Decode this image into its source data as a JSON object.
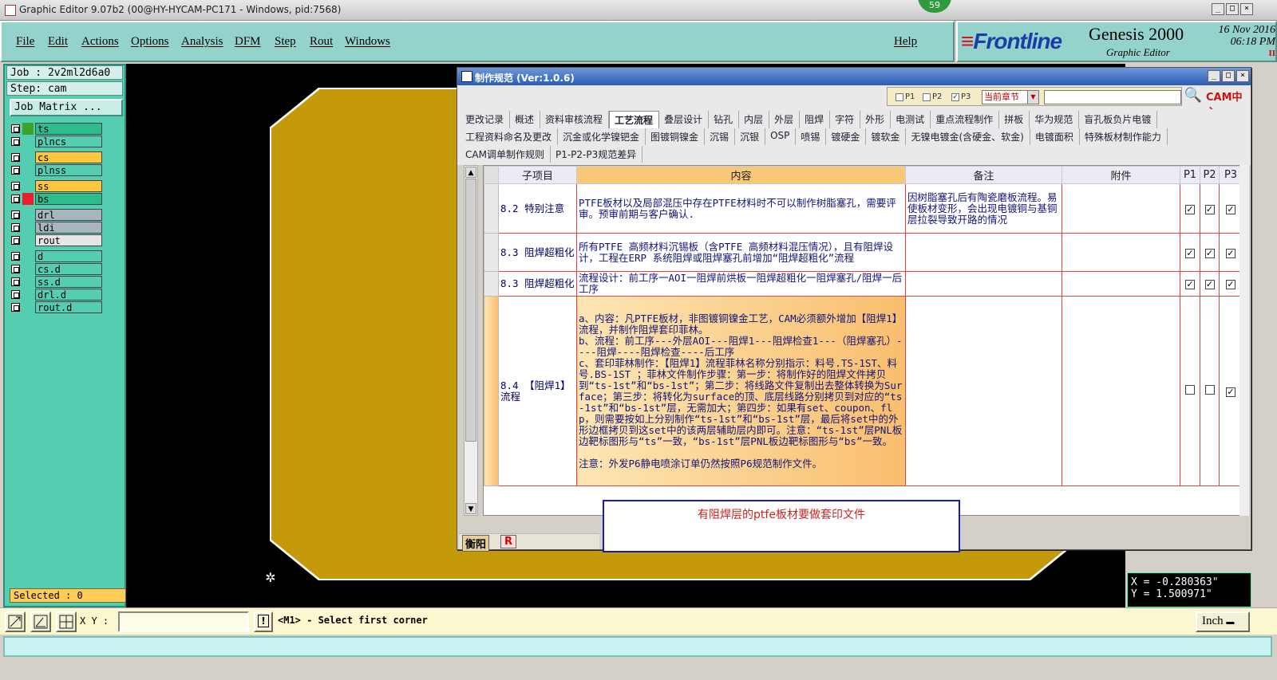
{
  "titlebar": {
    "title": "Graphic Editor 9.07b2 (00@HY-HYCAM-PC171 - Windows, pid:7568)",
    "min": "_",
    "max": "□",
    "close": "×"
  },
  "badge": "59",
  "menu": [
    "File",
    "Edit",
    "Actions",
    "Options",
    "Analysis",
    "DFM",
    "Step",
    "Rout",
    "Windows"
  ],
  "help": "Help",
  "brand": {
    "logo_mark": "≡",
    "logo": "Frontline",
    "product": "Genesis 2000",
    "sub": "Graphic Editor",
    "date": "16 Nov 2016",
    "time": "06:18 PM",
    "indicator": "II"
  },
  "left": {
    "job": "Job : 2v2ml2d6a0",
    "step": "Step: cam",
    "job_matrix": "Job Matrix ...",
    "selected": "Selected : 0"
  },
  "layers": [
    {
      "name": "ts",
      "color": "#2dbd8a",
      "swatch": "#3ca22e"
    },
    {
      "name": "plncs",
      "color": "#55cdb0",
      "swatch": "#55cdb0"
    },
    {
      "name": "cs",
      "color": "#ffc73b",
      "swatch": "#55cdb0"
    },
    {
      "name": "plnss",
      "color": "#55cdb0",
      "swatch": "#55cdb0"
    },
    {
      "name": "ss",
      "color": "#ffc73b",
      "swatch": "#55cdb0"
    },
    {
      "name": "bs",
      "color": "#2dbd8a",
      "swatch": "#e8202b"
    },
    {
      "name": "drl",
      "color": "#a8b6c0",
      "swatch": "#55cdb0"
    },
    {
      "name": "ldi",
      "color": "#a8b6c0",
      "swatch": "#55cdb0"
    },
    {
      "name": "rout",
      "color": "#e6e6e6",
      "swatch": "#55cdb0"
    },
    {
      "name": "d",
      "color": "#55cdb0",
      "swatch": "#55cdb0"
    },
    {
      "name": "cs.d",
      "color": "#55cdb0",
      "swatch": "#55cdb0"
    },
    {
      "name": "ss.d",
      "color": "#55cdb0",
      "swatch": "#55cdb0"
    },
    {
      "name": "drl.d",
      "color": "#55cdb0",
      "swatch": "#55cdb0"
    },
    {
      "name": "rout.d",
      "color": "#55cdb0",
      "swatch": "#55cdb0"
    }
  ],
  "coords": {
    "x": "X = -0.280363\"",
    "y": "Y = 1.500971\""
  },
  "bottom": {
    "xy_label": "X Y :",
    "xy_value": "",
    "warn": "!",
    "prompt": "<M1> - Select first corner",
    "unit": "Inch"
  },
  "dialog": {
    "title": "制作规范 (Ver:1.0.6)",
    "filters": [
      {
        "label": "P1",
        "checked": false
      },
      {
        "label": "P2",
        "checked": false
      },
      {
        "label": "P3",
        "checked": true
      }
    ],
    "chapter": "当前章节",
    "search_icon": "magnifier-icon",
    "cam_logo": "CAM",
    "cam_logo2": "中心",
    "tabs_row1": [
      "更改记录",
      "概述",
      "资料审核流程",
      "工艺流程",
      "叠层设计",
      "钻孔",
      "内层",
      "外层",
      "阻焊",
      "字符",
      "外形",
      "电测试",
      "重点流程制作",
      "拼板",
      "华为规范",
      "盲孔板负片电镀"
    ],
    "tabs_row2": [
      "工程资料命名及更改",
      "沉金或化学镍钯金",
      "图镀铜镍金",
      "沉锡",
      "沉银",
      "OSP",
      "喷锡",
      "镀硬金",
      "镀软金",
      "无镍电镀金(含硬金、软金)",
      "电镀面积",
      "特殊板材制作能力"
    ],
    "tabs_row3": [
      "CAM调单制作规则",
      "P1-P2-P3规范差异"
    ],
    "active_tab": "工艺流程",
    "columns": [
      "子项目",
      "内容",
      "备注",
      "附件",
      "P1",
      "P2",
      "P3"
    ],
    "rows": [
      {
        "item": "8.2 特别注意",
        "content": "PTFE板材以及局部混压中存在PTFE材料时不可以制作树脂塞孔，需要评审。预审前期与客户确认.",
        "note": "因树脂塞孔后有陶瓷磨板流程。易使板材变形，会出现电镀铜与基铜层拉裂导致开路的情况",
        "att": "",
        "p1": true,
        "p2": true,
        "p3": true
      },
      {
        "item": "8.3 阻焊超粗化",
        "content": "所有PTFE 高频材料沉锡板（含PTFE 高频材料混压情况），且有阻焊设计，工程在ERP 系统阻焊或阻焊塞孔前增加“阻焊超粗化”流程",
        "note": "",
        "att": "",
        "p1": true,
        "p2": true,
        "p3": true
      },
      {
        "item": "8.3 阻焊超粗化",
        "content": "流程设计：前工序一AOI一阻焊前烘板一阻焊超粗化一阻焊塞孔/阻焊一后工序",
        "note": "",
        "att": "",
        "p1": true,
        "p2": true,
        "p3": true
      },
      {
        "item": "8.4 【阻焊1】流程",
        "content": "a、内容：凡PTFE板材，非图镀铜镍金工艺，CAM必须额外增加【阻焊1】流程，并制作阻焊套印菲林。\nb、流程：前工序---外层AOI---阻焊1---阻焊检查1---（阻焊塞孔）----阻焊----阻焊检查----后工序\nc、套印菲林制作：【阻焊1】流程菲林名称分别指示：料号.TS-1ST、料号.BS-1ST ；菲林文件制作步骤：第一步：将制作好的阻焊文件拷贝到“ts-1st”和“bs-1st”；第二步：将线路文件复制出去整体转换为Surface；第三步：将转化为surface的顶、底层线路分别拷贝到对应的“ts-1st”和“bs-1st”层，无需加大；第四步：如果有set、coupon、flp，则需要按如上分别制作“ts-1st”和“bs-1st”层，最后将set中的外形边框拷贝到这set中的该两层辅助层内即可。注意：“ts-1st”层PNL板边靶标图形与“ts”一致，“bs-1st”层PNL板边靶标图形与“bs”一致。\n\n注意：外发P6静电喷涂订单仍然按照P6规范制作文件。",
        "note": "",
        "att": "",
        "p1": false,
        "p2": false,
        "p3": true
      }
    ],
    "note": "有阻焊层的ptfe板材要做套印文件",
    "status1": "衡阳",
    "status2": "R"
  }
}
